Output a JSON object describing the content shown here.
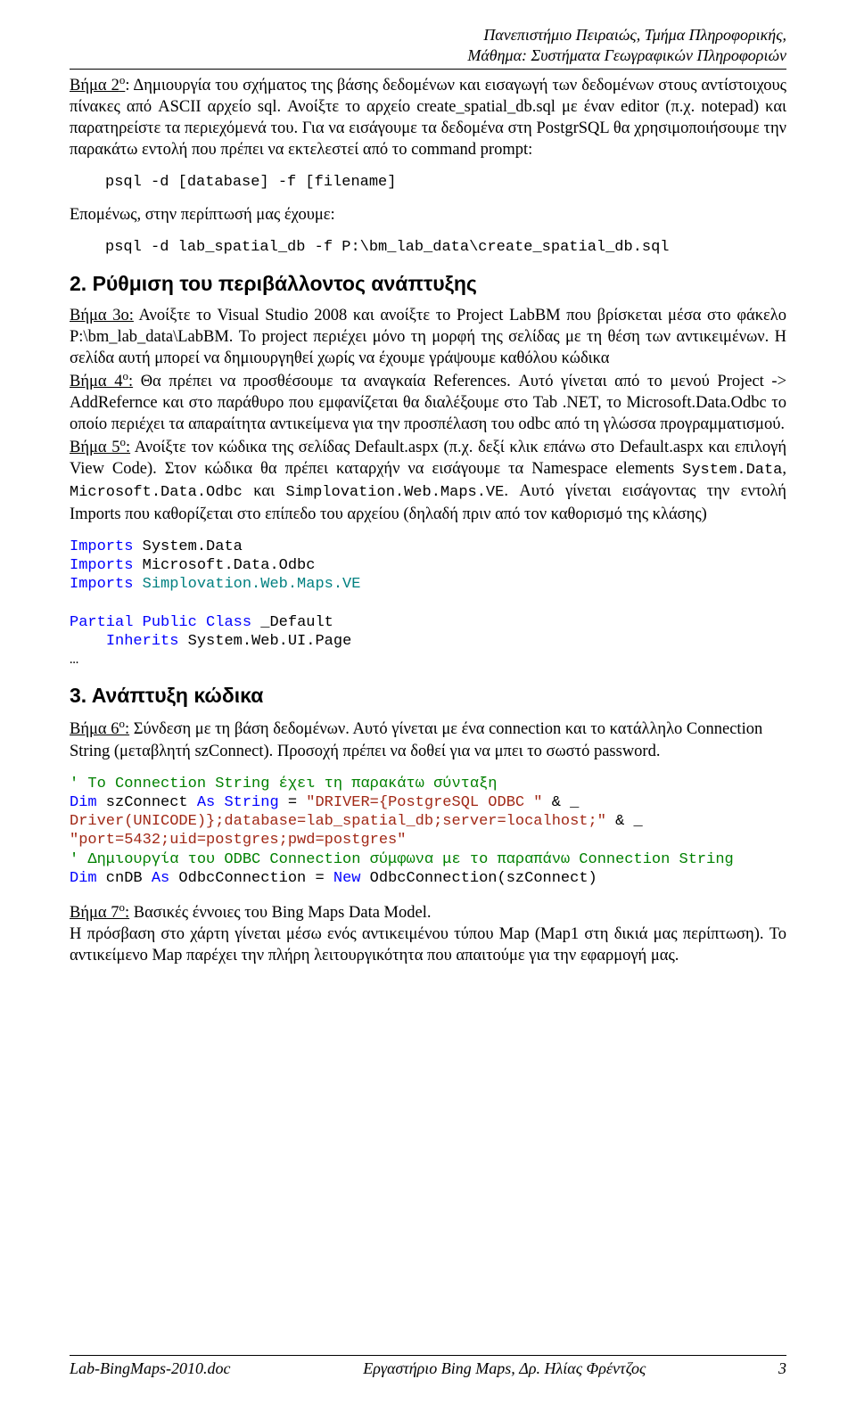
{
  "header": {
    "line1": "Πανεπιστήμιο Πειραιώς, Τμήμα Πληροφορικής,",
    "line2": "Μάθημα: Συστήματα Γεωγραφικών Πληροφοριών"
  },
  "step2": {
    "label": "Βήμα 2",
    "sup": "ο",
    "colon": ":",
    "text": " Δημιουργία του σχήματος της βάσης δεδομένων και εισαγωγή των δεδομένων στους αντίστοιχους πίνακες από ASCII αρχείο sql. Ανοίξτε το αρχείο create_spatial_db.sql με έναν editor (π.χ. notepad) και παρατηρείστε τα περιεχόμενά του. Για να εισάγουμε τα δεδομένα στη PostgrSQL θα χρησιμοποιήσουμε την παρακάτω εντολή που πρέπει να εκτελεστεί από το command prompt:"
  },
  "code1": "psql -d [database] -f [filename]",
  "follow1": "Επομένως, στην περίπτωσή μας έχουμε:",
  "code2": "psql -d lab_spatial_db -f P:\\bm_lab_data\\create_spatial_db.sql",
  "section2_title": "2. Ρύθμιση του περιβάλλοντος ανάπτυξης",
  "step3": {
    "label": "Βήμα 3ο:",
    "text_a": " Ανοίξτε το Visual Studio 2008 και ανοίξτε το Project LabBM που βρίσκεται μέσα στο φάκελο P:\\bm_lab_data\\LabBM. Το project περιέχει μόνο τη μορφή της σελίδας με τη θέση των αντικειμένων. Η σελίδα αυτή μπορεί να δημιουργηθεί χωρίς να έχουμε γράψουμε καθόλου κώδικα"
  },
  "step4": {
    "label": "Βήμα 4",
    "sup": "ο",
    "text": " Θα πρέπει να προσθέσουμε τα αναγκαία References. Αυτό γίνεται από το μενού Project -> AddRefernce και στο παράθυρο που εμφανίζεται θα διαλέξουμε στο Tab .NET, το Microsoft.Data.Odbc το οποίο περιέχει τα απαραίτητα αντικείμενα για την προσπέλαση του odbc από τη γλώσσα προγραμματισμού."
  },
  "step5": {
    "label": "Βήμα 5",
    "sup": "ο",
    "text_a": " Ανοίξτε τον κώδικα της σελίδας Default.aspx (π.χ. δεξί κλικ επάνω στο Default.aspx και επιλογή View Code). Στον κώδικα θα πρέπει καταρχήν να εισάγουμε τα Namespace elements ",
    "ns1": "System.Data",
    "comma1": ", ",
    "ns2": "Microsoft.Data.Odbc",
    "and": " και ",
    "ns3": "Simplovation.Web.Maps.VE",
    "dot": ".",
    "text_b": " Αυτό γίνεται εισάγοντας την εντολή Imports που καθορίζεται στο επίπεδο του αρχείου (δηλαδή πριν από τον καθορισμό της κλάσης)"
  },
  "codeblock": {
    "l1a": "Imports",
    "l1b": " System.Data",
    "l2a": "Imports",
    "l2b": " Microsoft.Data.Odbc",
    "l3a": "Imports",
    "l3b": " Simplovation.Web.Maps.VE",
    "l4": "",
    "l5a": "Partial",
    "l5b": " Public",
    "l5c": " Class",
    "l5d": " _Default",
    "l6a": "    Inherits",
    "l6b": " System.Web.UI.Page",
    "l7": "…"
  },
  "section3_title": "3. Ανάπτυξη κώδικα",
  "step6": {
    "label": "Βήμα 6",
    "sup": "ο",
    "text": " Σύνδεση με τη βάση δεδομένων. Αυτό γίνεται με ένα connection και το κατάλληλο Connection String (μεταβλητή szConnect).  Προσοχή πρέπει να δοθεί για να μπει το σωστό password."
  },
  "conn": {
    "c1": "' Το Connection String έχει τη παρακάτω σύνταξη",
    "l2_dim": "Dim",
    "l2_rest": " szConnect ",
    "l2_as": "As",
    "l2_rest2": " ",
    "l2_string": "String",
    "l2_eq": " = ",
    "l2_s1": "\"DRIVER={PostgreSQL ODBC \"",
    "l2_amp": " & _",
    "l3_s1": "Driver(UNICODE)};database=lab_spatial_db;server=localhost;\"",
    "l3_amp": " & _",
    "l4_s1": "\"port=5432;uid=postgres;pwd=postgres\"",
    "c2": "' Δημιουργία του ODBC Connection σύμφωνα με το παραπάνω Connection String",
    "l6_dim": "Dim",
    "l6_rest": " cnDB ",
    "l6_as": "As",
    "l6_rest2": " OdbcConnection = ",
    "l6_new": "New",
    "l6_rest3": " OdbcConnection(szConnect)"
  },
  "step7": {
    "label": "Βήμα 7",
    "sup": "ο",
    "head": " Βασικές έννοιες του Bing Maps Data Model.",
    "text": "Η πρόσβαση στο χάρτη γίνεται μέσω ενός αντικειμένου τύπου Map (Map1 στη δικιά μας περίπτωση). Το αντικείμενο Map παρέχει την πλήρη λειτουργικότητα που απαιτούμε για την εφαρμογή μας."
  },
  "footer": {
    "left": "Lab-BingMaps-2010.doc",
    "center": "Εργαστήριο Bing Maps, Δρ. Ηλίας Φρέντζος",
    "right": "3"
  }
}
